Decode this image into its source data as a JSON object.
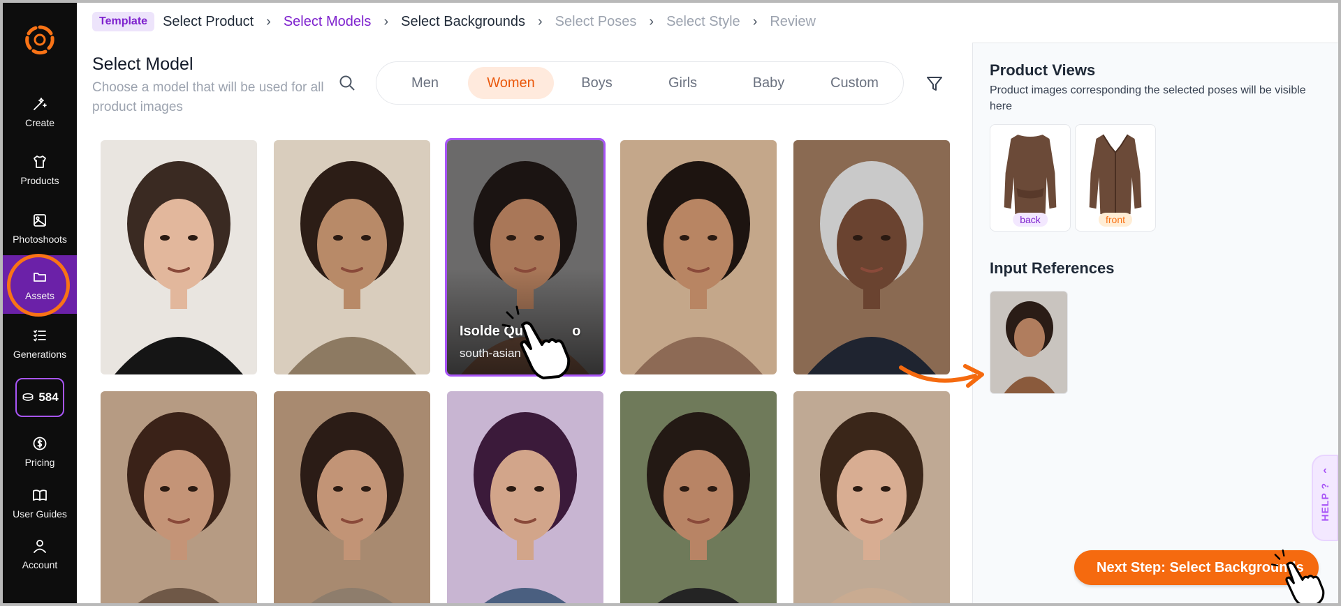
{
  "sidebar": {
    "items": [
      {
        "label": "Create"
      },
      {
        "label": "Products"
      },
      {
        "label": "Photoshoots"
      },
      {
        "label": "Assets"
      },
      {
        "label": "Generations"
      },
      {
        "label": "Pricing"
      },
      {
        "label": "User Guides"
      },
      {
        "label": "Account"
      }
    ],
    "credits": "584",
    "active": "Assets"
  },
  "breadcrumb": {
    "tag": "Template",
    "steps": [
      "Select Product",
      "Select Models",
      "Select Backgrounds",
      "Select Poses",
      "Select Style",
      "Review"
    ],
    "current": "Select Models"
  },
  "main": {
    "title": "Select Model",
    "subtitle": "Choose a model that will be used for all product images",
    "tabs": [
      "Men",
      "Women",
      "Boys",
      "Girls",
      "Baby",
      "Custom"
    ],
    "active_tab": "Women",
    "selected_model": {
      "name": "Isolde Qu",
      "name_tail": "o",
      "tag": "south-asian"
    },
    "model_count_visible": 10
  },
  "right_panel": {
    "views_title": "Product Views",
    "views_desc": "Product images corresponding the selected poses will be visible here",
    "views": [
      {
        "tag": "back"
      },
      {
        "tag": "front"
      }
    ],
    "references_title": "Input References"
  },
  "help_label": "HELP ?",
  "next_button": "Next Step: Select Backgrounds",
  "colors": {
    "brand": "#6b21a8",
    "accent": "#f56a0f",
    "purple_text": "#7e22ce"
  }
}
